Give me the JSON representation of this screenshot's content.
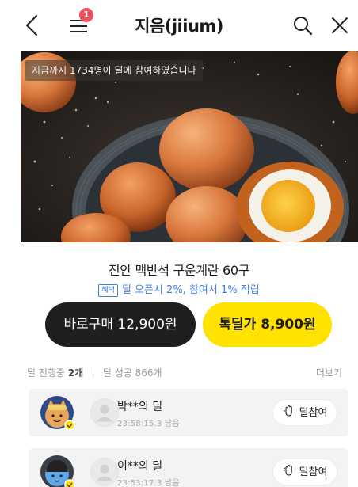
{
  "header": {
    "title": "지음(jiium)",
    "menu_badge": "1"
  },
  "hero": {
    "banner": "지금까지 1734명이 딜에 참여하였습니다"
  },
  "product": {
    "title": "진안 맥반석 구운계란 60구",
    "benefit_tag": "혜택",
    "benefit_text": "딜 오픈시 2%, 참여시 1% 적립"
  },
  "buttons": {
    "buy": "바로구매 12,900원",
    "deal": "톡딜가 8,900원"
  },
  "stats": {
    "in_progress_label": "딜 진행중",
    "in_progress_count": "2개",
    "success_label": "딜 성공 866개",
    "more": "더보기"
  },
  "deals": [
    {
      "name": "박**의 딜",
      "timer": "23:58:15.3 남음",
      "join_label": "딜참여"
    },
    {
      "name": "이**의 딜",
      "timer": "23:53:17.3 남음",
      "join_label": "딜참여"
    }
  ],
  "colors": {
    "accent_yellow": "#ffe200",
    "benefit_blue": "#3f7fe0",
    "badge_red": "#f0505a",
    "dark_button": "#1f1f1f"
  }
}
